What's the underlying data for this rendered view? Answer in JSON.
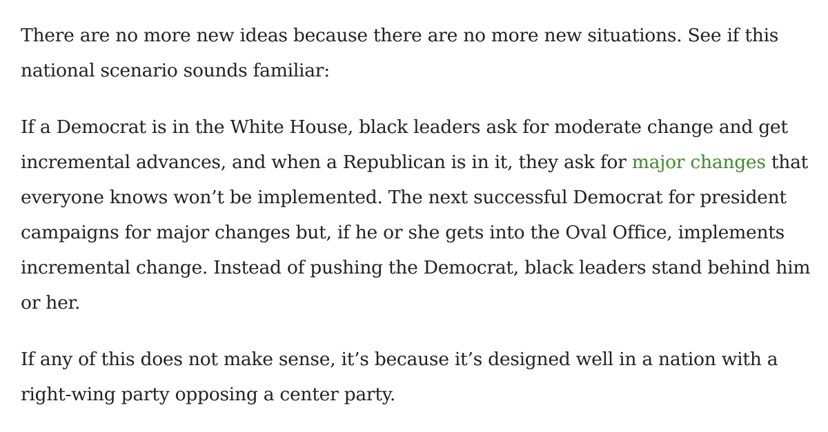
{
  "article": {
    "paragraph_1": "There are no more new ideas because there are no more new situations. See if this national scenario sounds familiar:",
    "paragraph_2": {
      "before_link": "If a Democrat is in the White House, black leaders ask for moderate change and get incremental advances, and when a Republican is in it, they ask for ",
      "link_text": "major changes",
      "after_link": " that everyone knows won’t be implemented. The next successful Democrat for president campaigns for major changes but, if he or she gets into the Oval Office, implements incremental change. Instead of pushing the Democrat, black leaders stand behind him or her."
    },
    "paragraph_3": "If any of this does not make sense, it’s because it’s designed well in a nation with a right-wing party opposing a center party."
  },
  "colors": {
    "text": "#222222",
    "link": "#3f8a2c",
    "background": "#ffffff"
  }
}
